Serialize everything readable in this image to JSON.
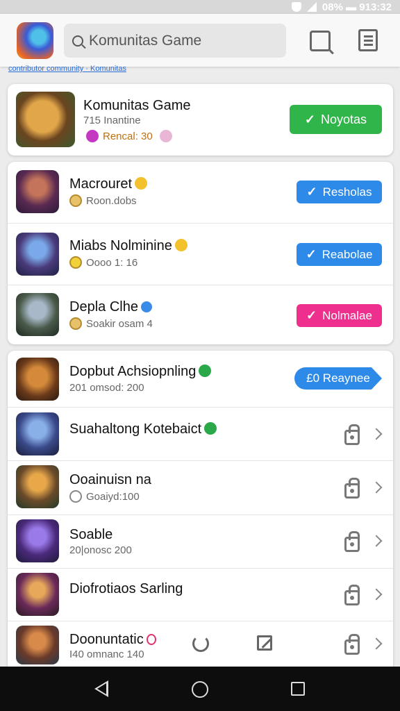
{
  "status": {
    "text": "08% ▬ 913:32"
  },
  "header": {
    "search_placeholder": "Komunitas Game"
  },
  "link_strip": "contributor community · Komunitas",
  "featured": {
    "title": "Komunitas Game",
    "subtitle": "715 Inantine",
    "meta": "Rencal: 30",
    "button": "Noyotas",
    "colors": {
      "button": "#2fb54a"
    }
  },
  "group1": [
    {
      "title": "Macrouret",
      "subtitle": "Roon.dobs",
      "button": "Resholas",
      "button_color": "blue",
      "badge": "emoji"
    },
    {
      "title": "Miabs Nolminine",
      "subtitle": "Oooo 1: 16",
      "button": "Reabolae",
      "button_color": "blue",
      "badge": "emoji"
    },
    {
      "title": "Depla Clhe",
      "subtitle": "Soakir osam 4",
      "button": "Nolmalae",
      "button_color": "pink",
      "badge": "blue-check"
    }
  ],
  "group2": [
    {
      "title": "Dopbut Achsiopnling",
      "subtitle": "201 omsod: 200",
      "action": "tag",
      "tag_label": "£0 Reaynee",
      "badge": "green-check"
    },
    {
      "title": "Suahaltong Kotebaict",
      "subtitle": "",
      "action": "lock",
      "badge": "green-check"
    },
    {
      "title": "Ooainuisn na",
      "subtitle": "Goaiyd:100",
      "action": "lock"
    },
    {
      "title": "Soable",
      "subtitle": "20|onosc 200",
      "action": "lock"
    },
    {
      "title": "Diofrotiaos Sarling",
      "subtitle": "",
      "action": "lock"
    },
    {
      "title": "Doonuntatic",
      "subtitle": "I40 omnanc 140",
      "action": "lock",
      "badge": "pink"
    }
  ]
}
